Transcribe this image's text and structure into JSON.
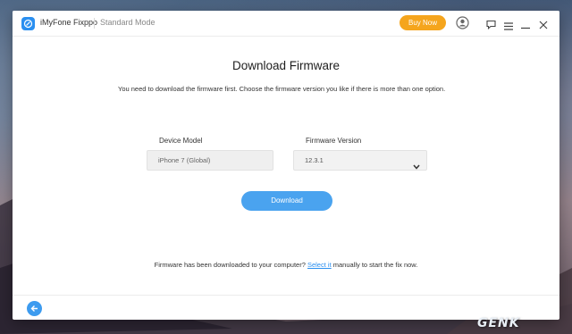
{
  "titlebar": {
    "app_name": "iMyFone Fixppo",
    "mode": "Standard Mode",
    "buy_label": "Buy Now",
    "icons": [
      "user-icon",
      "feedback-icon",
      "menu-icon",
      "minimize-icon",
      "close-icon"
    ]
  },
  "main": {
    "title": "Download Firmware",
    "instructions": "You need to download the firmware first. Choose the firmware version you like if there is more than one option.",
    "device_model_label": "Device Model",
    "device_model_value": "iPhone 7 (Global)",
    "firmware_version_label": "Firmware Version",
    "firmware_version_value": "12.3.1",
    "download_label": "Download"
  },
  "footer": {
    "note_prefix": "Firmware has been downloaded to your computer? ",
    "link_text": "Select it",
    "note_suffix": " manually to start the fix now.",
    "back_icon": "back-arrow-icon"
  },
  "watermark": {
    "text": "GENK"
  },
  "colors": {
    "accent": "#2a8ff0",
    "buy_button": "#f5a51d",
    "download_button": "#4aa3ef"
  }
}
